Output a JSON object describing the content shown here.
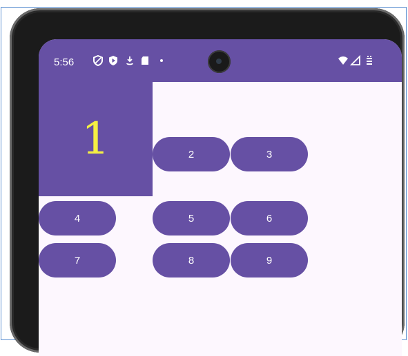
{
  "statusbar": {
    "time": "5:56",
    "left_icons": [
      "shield-icon",
      "play-protect-icon",
      "download-icon",
      "sd-card-icon",
      "dot-icon"
    ],
    "right_icons": [
      "wifi-icon",
      "signal-icon",
      "battery-icon"
    ]
  },
  "grid": {
    "big_tile": "1",
    "buttons": [
      "2",
      "3",
      "4",
      "5",
      "6",
      "7",
      "8",
      "9"
    ]
  },
  "colors": {
    "primary": "#6650a4",
    "background": "#fdf7fe",
    "big_digit": "#f5f043"
  }
}
